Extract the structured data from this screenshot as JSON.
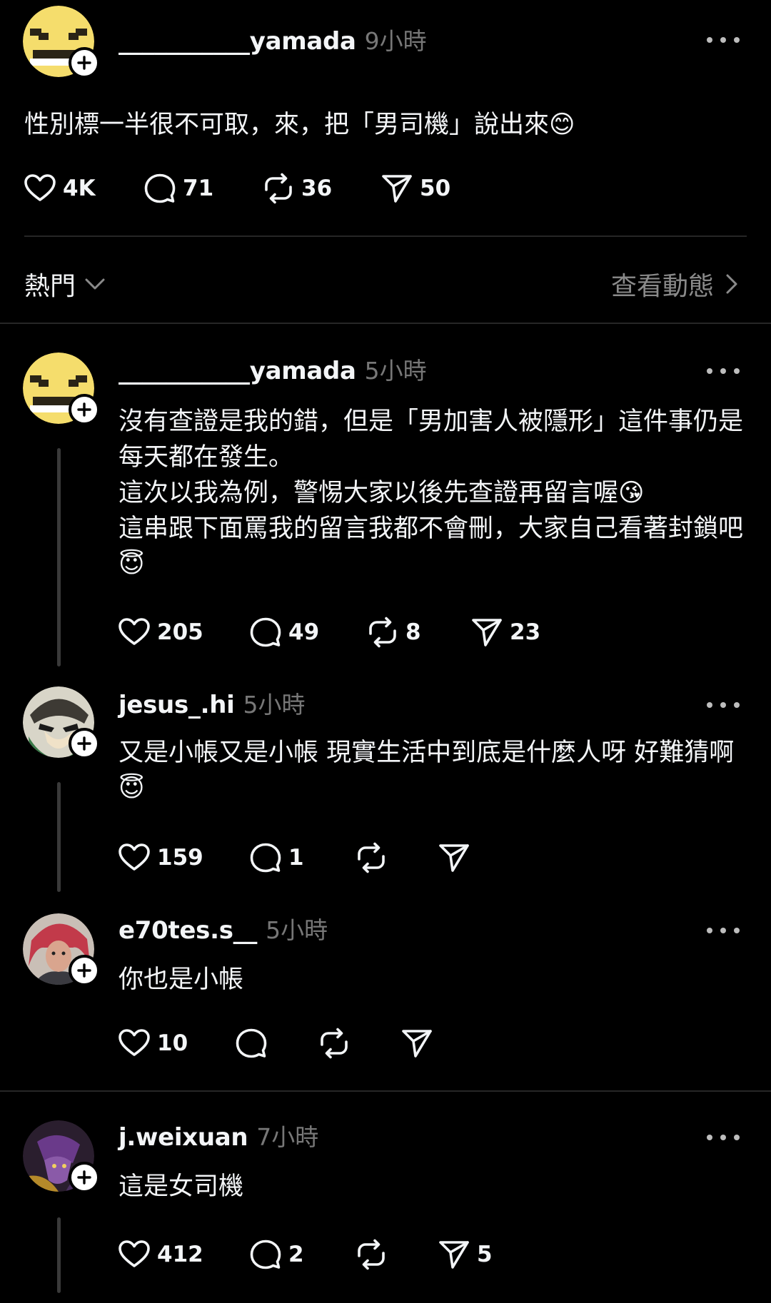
{
  "original_post": {
    "username": "___________yamada",
    "time": "9小時",
    "text": "性別標一半很不可取，來，把「男司機」說出來😊",
    "likes": "4K",
    "comments": "71",
    "reposts": "36",
    "shares": "50"
  },
  "sort_bar": {
    "sort_label": "熱門",
    "activity_label": "查看動態"
  },
  "replies": [
    {
      "username": "___________yamada",
      "time": "5小時",
      "lines": [
        "沒有查證是我的錯，但是「男加害人被隱形」這件事仍是每天都在發生。",
        "這次以我為例，警惕大家以後先查證再留言喔😘",
        "這串跟下面罵我的留言我都不會刪，大家自己看著封鎖吧😇"
      ],
      "likes": "205",
      "comments": "49",
      "reposts": "8",
      "shares": "23"
    },
    {
      "username": "jesus_.hi",
      "time": "5小時",
      "lines": [
        "又是小帳又是小帳 現實生活中到底是什麼人呀 好難猜啊😇"
      ],
      "likes": "159",
      "comments": "1",
      "reposts": "",
      "shares": ""
    },
    {
      "username": "e70tes.s__",
      "time": "5小時",
      "lines": [
        "你也是小帳"
      ],
      "likes": "10",
      "comments": "",
      "reposts": "",
      "shares": ""
    },
    {
      "username": "j.weixuan",
      "time": "7小時",
      "lines": [
        "這是女司機"
      ],
      "likes": "412",
      "comments": "2",
      "reposts": "",
      "shares": "5"
    }
  ],
  "icons": {
    "like": "heart-icon",
    "comment": "comment-bubble-icon",
    "repost": "repost-icon",
    "share": "send-icon",
    "more": "more-icon",
    "follow": "plus-icon"
  }
}
